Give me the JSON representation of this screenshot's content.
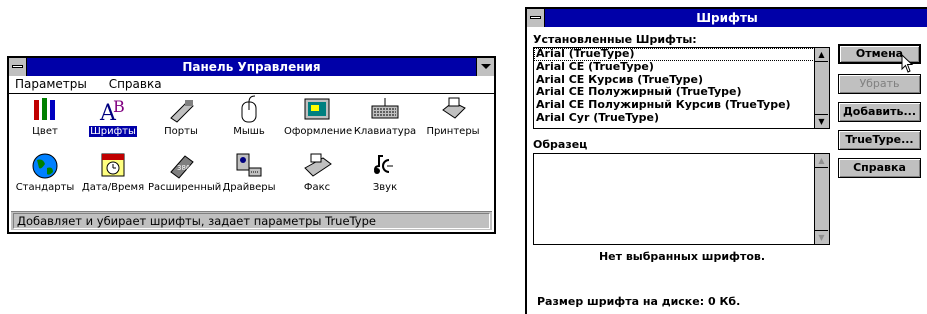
{
  "control_panel": {
    "title": "Панель Управления",
    "menu": [
      "Параметры",
      "Справка"
    ],
    "items": [
      {
        "label": "Цвет",
        "icon": "color-icon"
      },
      {
        "label": "Шрифты",
        "icon": "fonts-icon",
        "selected": true
      },
      {
        "label": "Порты",
        "icon": "ports-icon"
      },
      {
        "label": "Мышь",
        "icon": "mouse-icon"
      },
      {
        "label": "Оформление",
        "icon": "desktop-icon"
      },
      {
        "label": "Клавиатура",
        "icon": "keyboard-icon"
      },
      {
        "label": "Принтеры",
        "icon": "printers-icon"
      },
      {
        "label": "Стандарты",
        "icon": "international-icon"
      },
      {
        "label": "Дата/Время",
        "icon": "datetime-icon"
      },
      {
        "label": "Расширенный",
        "icon": "enhanced-icon"
      },
      {
        "label": "Драйверы",
        "icon": "drivers-icon"
      },
      {
        "label": "Факс",
        "icon": "fax-icon"
      },
      {
        "label": "Звук",
        "icon": "sound-icon"
      }
    ],
    "status": "Добавляет и убирает шрифты, задает параметры TrueType"
  },
  "fonts_dialog": {
    "title": "Шрифты",
    "installed_label": "Установленные Шрифты:",
    "installed_fonts": [
      "Arial (TrueType)",
      "Arial CE (TrueType)",
      "Arial CE Курсив (TrueType)",
      "Arial CE Полужирный (TrueType)",
      "Arial CE Полужирный Курсив (TrueType)",
      "Arial Cyr (TrueType)"
    ],
    "sample_label": "Образец",
    "no_selection": "Нет выбранных шрифтов.",
    "size_label": "Размер шрифта на диске:  0 Кб.",
    "buttons": {
      "cancel": "Отмена",
      "remove": "Убрать",
      "add": "Добавить...",
      "truetype": "TrueType...",
      "help": "Справка"
    }
  },
  "colors": {
    "titlebar": "#0000a8",
    "face": "#c0c0c0"
  }
}
